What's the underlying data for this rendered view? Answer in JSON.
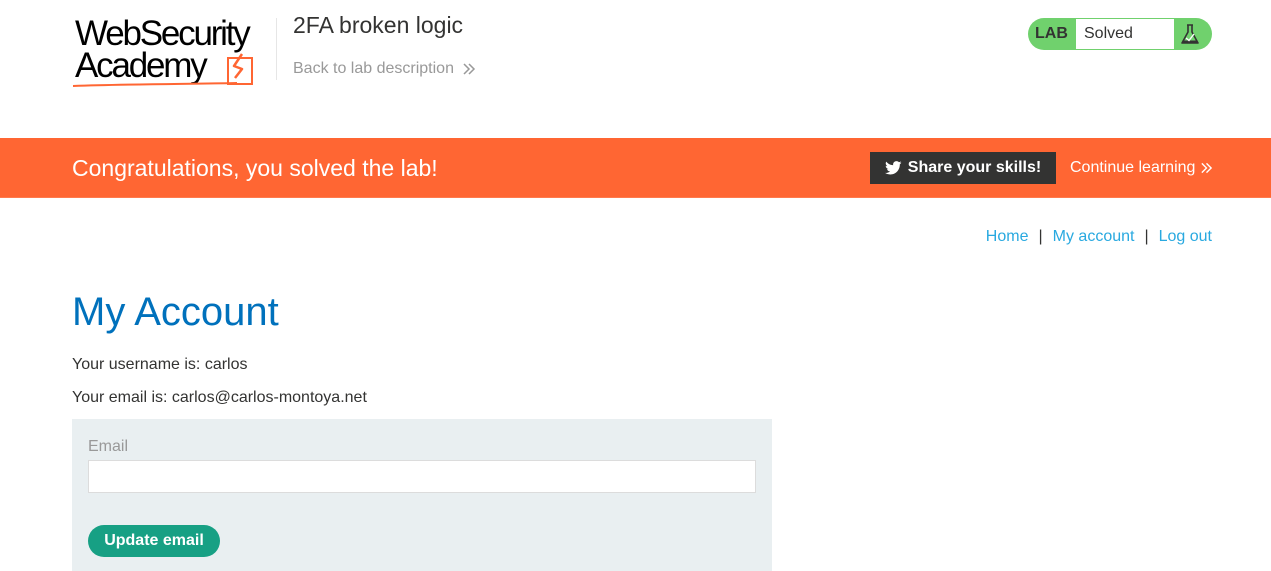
{
  "logo": {
    "line1": "WebSecurity",
    "line2": "Academy"
  },
  "lab": {
    "title": "2FA broken logic",
    "back_link": "Back to lab description",
    "status_tag": "LAB",
    "status_text": "Solved",
    "status_icon": "flask-icon"
  },
  "banner": {
    "message": "Congratulations, you solved the lab!",
    "share_label": "Share your skills!",
    "share_icon": "twitter-icon",
    "continue_label": "Continue learning"
  },
  "nav": {
    "home": "Home",
    "sep1": "|",
    "my_account": "My account",
    "sep2": "|",
    "logout": "Log out"
  },
  "account": {
    "title": "My Account",
    "username_line": "Your username is: carlos",
    "email_line": "Your email is: carlos@carlos-montoya.net"
  },
  "form": {
    "email_label": "Email",
    "email_value": "",
    "update_label": "Update email"
  },
  "colors": {
    "banner": "#ff6633",
    "solved": "#70d16d",
    "title": "#0071bc",
    "link": "#29a9e0",
    "button": "#17a084"
  }
}
